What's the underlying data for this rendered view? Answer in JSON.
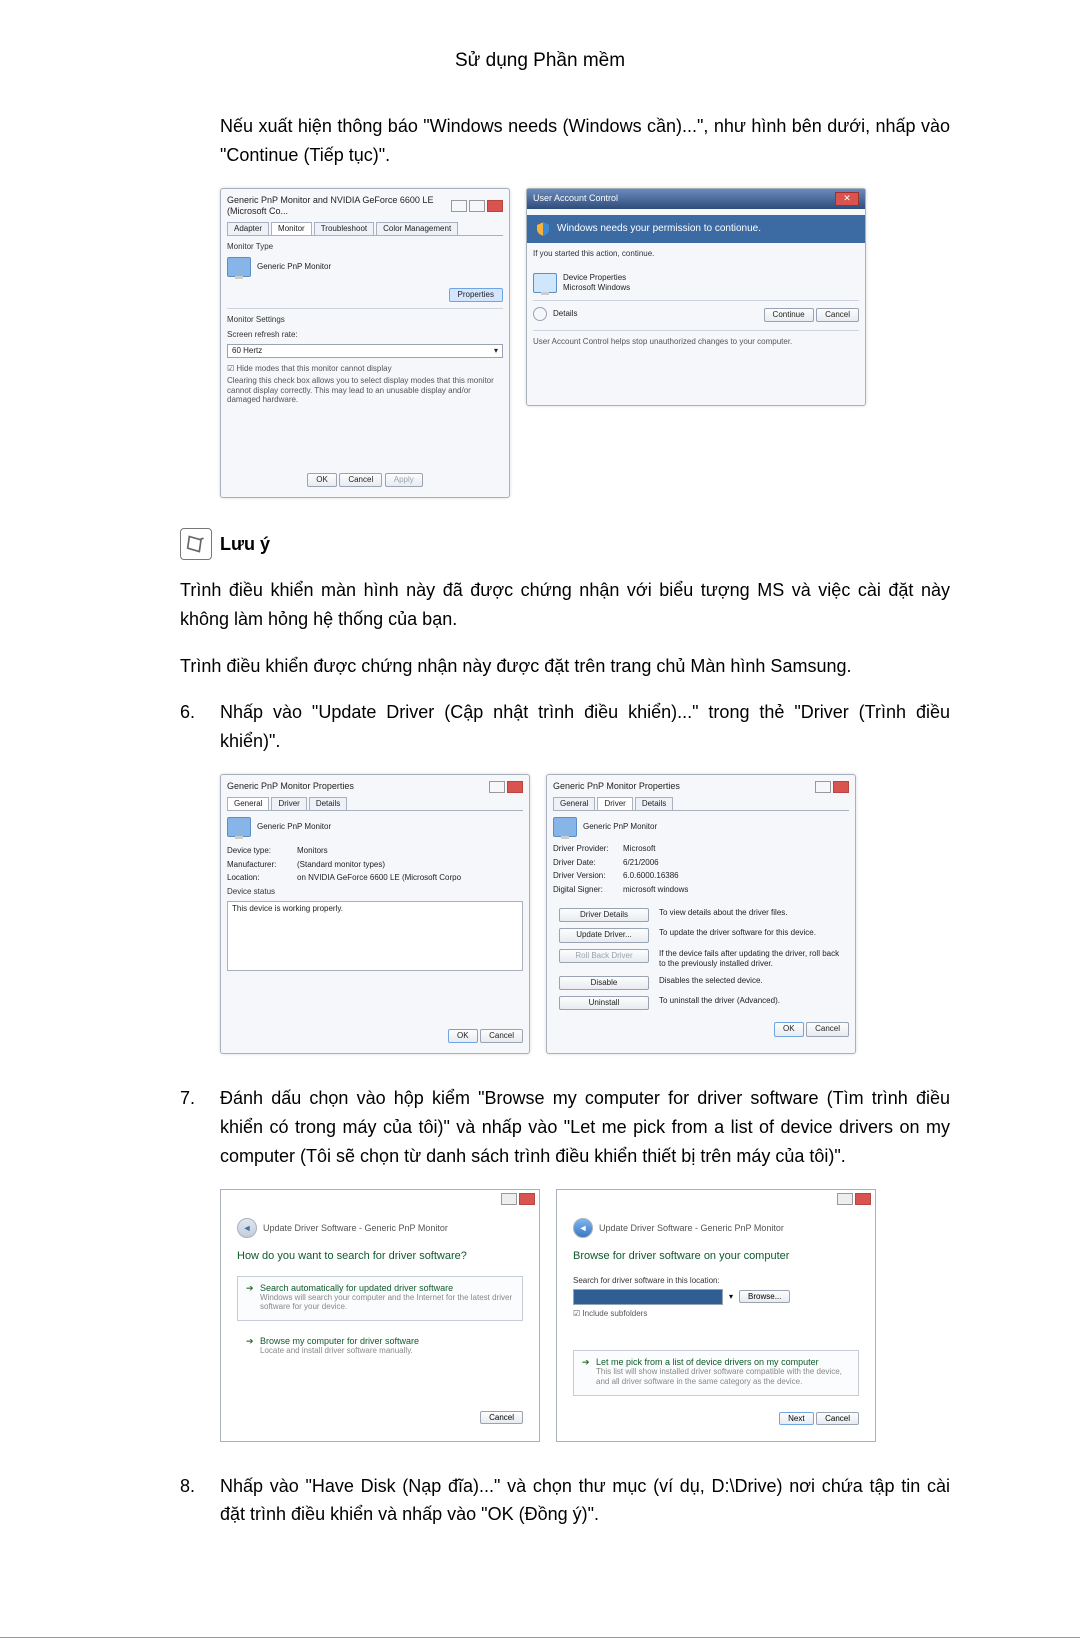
{
  "header": {
    "title": "Sử dụng Phần mềm"
  },
  "intro_para": "Nếu xuất hiện thông báo \"Windows needs (Windows cần)...\", như hình bên dưới, nhấp vào \"Continue (Tiếp tục)\".",
  "fig1": {
    "title": "Generic PnP Monitor and NVIDIA GeForce 6600 LE (Microsoft Co...",
    "tab_adapter": "Adapter",
    "tab_monitor": "Monitor",
    "tab_troubleshoot": "Troubleshoot",
    "tab_color": "Color Management",
    "sec_type": "Monitor Type",
    "monitor_name": "Generic PnP Monitor",
    "btn_properties": "Properties",
    "sec_settings": "Monitor Settings",
    "lbl_refresh": "Screen refresh rate:",
    "refresh_val": "60 Hertz",
    "chk_hide": "Hide modes that this monitor cannot display",
    "hide_note": "Clearing this check box allows you to select display modes that this monitor cannot display correctly. This may lead to an unusable display and/or damaged hardware.",
    "ok": "OK",
    "cancel": "Cancel",
    "apply": "Apply"
  },
  "fig2": {
    "title": "User Account Control",
    "heading": "Windows needs your permission to contionue.",
    "started": "If you started this action, continue.",
    "dev_label": "Device Properties",
    "dev_vendor": "Microsoft Windows",
    "details": "Details",
    "continue": "Continue",
    "cancel": "Cancel",
    "footer": "User Account Control helps stop unauthorized changes to your computer."
  },
  "note": {
    "title": "Lưu ý",
    "p1": "Trình điều khiển màn hình này đã được chứng nhận với biểu tượng MS và việc cài đặt này không làm hỏng hệ thống của bạn.",
    "p2": "Trình điều khiển được chứng nhận này được đặt trên trang chủ Màn hình Samsung."
  },
  "step6": {
    "num": "6.",
    "text": "Nhấp vào \"Update Driver (Cập nhật trình điều khiển)...\" trong thẻ \"Driver (Trình điều khiển)\"."
  },
  "fig3": {
    "title": "Generic PnP Monitor Properties",
    "tab_general": "General",
    "tab_driver": "Driver",
    "tab_details": "Details",
    "monitor_name": "Generic PnP Monitor",
    "lbl_type": "Device type:",
    "val_type": "Monitors",
    "lbl_mfr": "Manufacturer:",
    "val_mfr": "(Standard monitor types)",
    "lbl_loc": "Location:",
    "val_loc": "on NVIDIA GeForce 6600 LE (Microsoft Corpo",
    "sec_status": "Device status",
    "status": "This device is working properly.",
    "ok": "OK",
    "cancel": "Cancel"
  },
  "fig4": {
    "title": "Generic PnP Monitor Properties",
    "tab_general": "General",
    "tab_driver": "Driver",
    "tab_details": "Details",
    "monitor_name": "Generic PnP Monitor",
    "lbl_provider": "Driver Provider:",
    "val_provider": "Microsoft",
    "lbl_date": "Driver Date:",
    "val_date": "6/21/2006",
    "lbl_version": "Driver Version:",
    "val_version": "6.0.6000.16386",
    "lbl_signer": "Digital Signer:",
    "val_signer": "microsoft windows",
    "btn_details": "Driver Details",
    "desc_details": "To view details about the driver files.",
    "btn_update": "Update Driver...",
    "desc_update": "To update the driver software for this device.",
    "btn_rollback": "Roll Back Driver",
    "desc_rollback": "If the device fails after updating the driver, roll back to the previously installed driver.",
    "btn_disable": "Disable",
    "desc_disable": "Disables the selected device.",
    "btn_uninstall": "Uninstall",
    "desc_uninstall": "To uninstall the driver (Advanced).",
    "ok": "OK",
    "cancel": "Cancel"
  },
  "step7": {
    "num": "7.",
    "text": "Đánh dấu chọn vào hộp kiểm \"Browse my computer for driver software (Tìm trình điều khiển có trong máy của tôi)\" và nhấp vào \"Let me pick from a list of device drivers on my computer (Tôi sẽ chọn từ danh sách trình điều khiển thiết bị trên máy của tôi)\"."
  },
  "fig5": {
    "crumb": "Update Driver Software - Generic PnP Monitor",
    "q": "How do you want to search for driver software?",
    "opt1_title": "Search automatically for updated driver software",
    "opt1_desc": "Windows will search your computer and the Internet for the latest driver software for your device.",
    "opt2_title": "Browse my computer for driver software",
    "opt2_desc": "Locate and install driver software manually.",
    "cancel": "Cancel"
  },
  "fig6": {
    "crumb": "Update Driver Software - Generic PnP Monitor",
    "q": "Browse for driver software on your computer",
    "lbl_search": "Search for driver software in this location:",
    "browse": "Browse...",
    "chk_sub": "Include subfolders",
    "opt_title": "Let me pick from a list of device drivers on my computer",
    "opt_desc": "This list will show installed driver software compatible with the device, and all driver software in the same category as the device.",
    "next": "Next",
    "cancel": "Cancel"
  },
  "step8": {
    "num": "8.",
    "text": "Nhấp vào \"Have Disk (Nạp đĩa)...\" và chọn thư mục (ví dụ, D:\\Drive) nơi chứa tập tin cài đặt trình điều khiển và nhấp vào \"OK (Đồng ý)\"."
  }
}
